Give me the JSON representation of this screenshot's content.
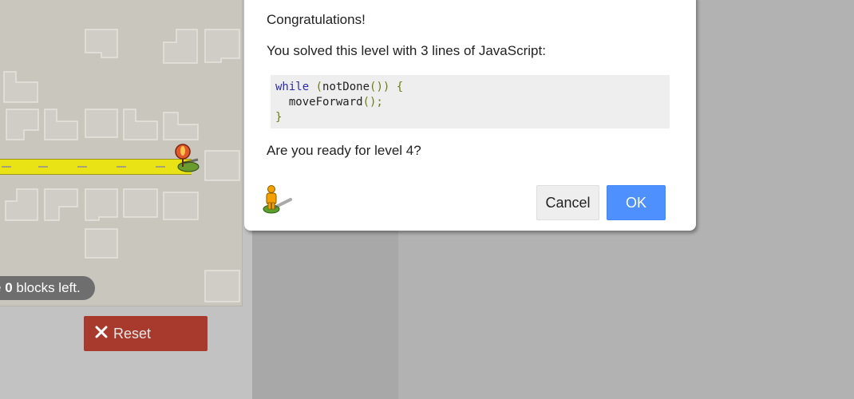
{
  "game": {
    "capacity_prefix": "e ",
    "capacity_count": "0",
    "capacity_suffix": " blocks left.",
    "reset_label": "Reset"
  },
  "dialog": {
    "heading": "Congratulations!",
    "solved_message": "You solved this level with 3 lines of JavaScript:",
    "code": {
      "line1_kw": "while",
      "line1_a": " (",
      "line1_call": "notDone",
      "line1_b": "()) {",
      "line2_call": "moveForward",
      "line2_punct": "();",
      "line3": "}"
    },
    "question": "Are you ready for level 4?",
    "cancel_label": "Cancel",
    "ok_label": "OK"
  },
  "colors": {
    "ok_button": "#4d90fe",
    "reset_button": "#a83a2d",
    "road": "#e9e215",
    "dialog_bg": "#ffffff"
  },
  "icons": {
    "reset": "close-x-icon",
    "marker": "map-pin-icon",
    "player": "pegman-icon"
  }
}
